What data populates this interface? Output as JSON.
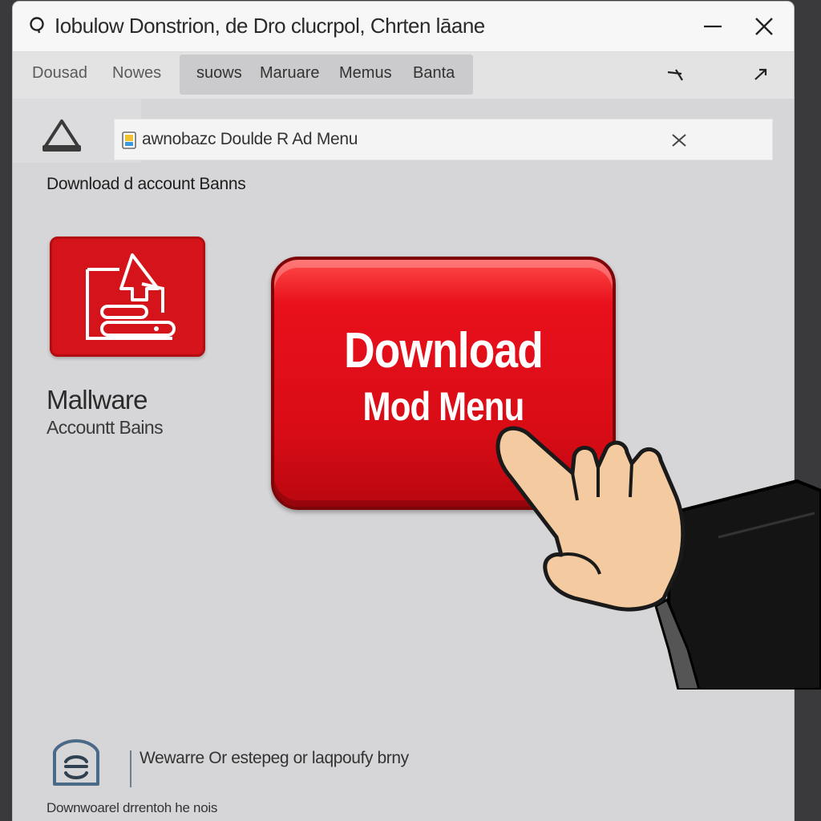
{
  "window": {
    "title": "Iobulow Donstrion, de Dro clucrpol, Chrten lāane"
  },
  "tabs": {
    "plain": [
      "Dousad",
      "Nowes"
    ],
    "grouped": [
      "suows",
      "Maruare",
      "Memus",
      "Banta"
    ]
  },
  "search": {
    "value": "awnobazc Doulde R Ad Menu"
  },
  "subheading": "Download d account Banns",
  "warning_panel": {
    "title": "Mallware",
    "subtitle": "Accountt Bains"
  },
  "download_button": {
    "line1": "Download",
    "line2": "Mod Menu"
  },
  "footer": {
    "text": "Wewarre Or estepeg or laqpoufy brny",
    "caption": "Downwoarel drrentoh he nois"
  },
  "colors": {
    "accent_red": "#d80c16",
    "window_bg": "#d6d6d8",
    "titlebar_bg": "#f7f7f7"
  },
  "icons": {
    "title": "search-icon",
    "minimize": "minimize-icon",
    "close": "close-icon",
    "back": "arrow-left-icon",
    "forward": "arrow-up-right-icon",
    "warning": "warning-triangle-icon",
    "favicon": "favicon-icon",
    "clear": "clear-x-icon",
    "app": "download-document-icon",
    "pointer": "pointing-hand-icon",
    "shield": "shield-icon"
  }
}
